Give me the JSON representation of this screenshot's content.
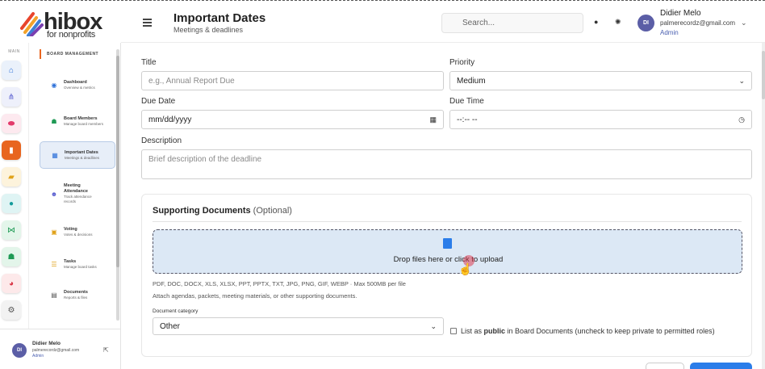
{
  "brand": {
    "name": "hibox",
    "tagline": "for nonprofits"
  },
  "header": {
    "title": "Important Dates",
    "subtitle": "Meetings & deadlines",
    "search_placeholder": "Search..."
  },
  "user": {
    "initials": "DI",
    "name": "Didier Melo",
    "email": "palmerecordz@gmail.com",
    "role": "Admin"
  },
  "rail": {
    "section_label": "MAIN",
    "icons": [
      "home-icon",
      "org-chart-icon",
      "pill-icon",
      "bookmark-icon",
      "folder-icon",
      "circle-icon",
      "nodes-icon",
      "team-icon",
      "pie-icon",
      "gear-icon"
    ]
  },
  "sidebar": {
    "section_label": "BOARD MANAGEMENT",
    "items": [
      {
        "label": "Dashboard",
        "desc": "Overview & metrics"
      },
      {
        "label": "Board Members",
        "desc": "Manage board members"
      },
      {
        "label": "Important Dates",
        "desc": "Meetings & deadlines"
      },
      {
        "label": "Meeting Attendance",
        "desc": "Track attendance records"
      },
      {
        "label": "Voting",
        "desc": "Votes & decisions"
      },
      {
        "label": "Tasks",
        "desc": "Manage board tasks"
      },
      {
        "label": "Documents",
        "desc": "Reports & files"
      }
    ]
  },
  "form": {
    "title_label": "Title",
    "title_placeholder": "e.g., Annual Report Due",
    "priority_label": "Priority",
    "priority_value": "Medium",
    "due_date_label": "Due Date",
    "due_date_value": "mm/dd/yyyy",
    "due_time_label": "Due Time",
    "due_time_value": "--:-- --",
    "description_label": "Description",
    "description_placeholder": "Brief description of the deadline"
  },
  "documents": {
    "heading": "Supporting Documents",
    "optional": "(Optional)",
    "drop_text": "Drop files here or click to upload",
    "formats": "PDF, DOC, DOCX, XLS, XLSX, PPT, PPTX, TXT, JPG, PNG, GIF, WEBP · Max 500MB per file",
    "attach_hint": "Attach agendas, packets, meeting materials, or other supporting documents.",
    "category_label": "Document category",
    "category_value": "Other",
    "public_prefix": "List as ",
    "public_bold": "public",
    "public_suffix": " in Board Documents (uncheck to keep private to permitted roles)"
  },
  "colors": {
    "accent": "#2b7de9",
    "brand_orange": "#e8651f",
    "avatar": "#5b5ea6"
  }
}
